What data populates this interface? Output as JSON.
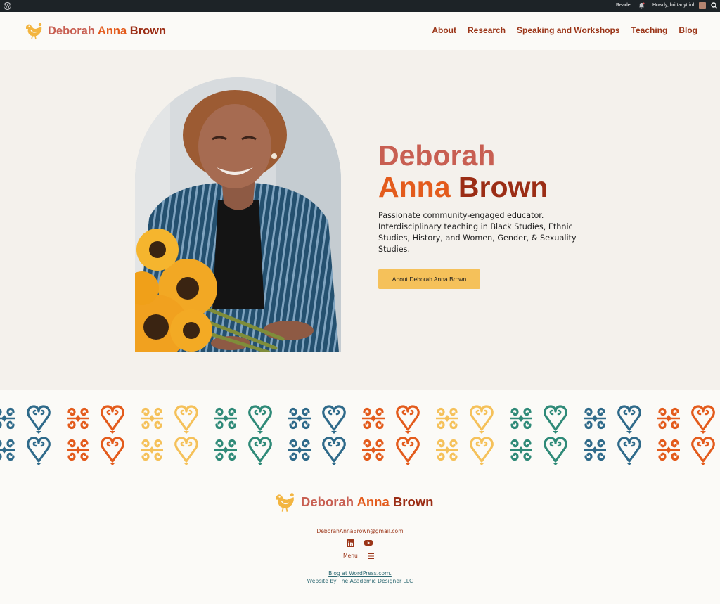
{
  "admin_bar": {
    "wp_logo": "wordpress-icon",
    "reader": "Reader",
    "notifications": "bell-icon",
    "howdy": "Howdy, brittanytrinh",
    "search": "search-icon"
  },
  "site": {
    "title_part1": "Deborah",
    "title_part2": "Anna",
    "title_part3": "Brown",
    "colors": {
      "rose": "#c85f52",
      "orange": "#e35b1c",
      "rust": "#9b2d15",
      "gold": "#f5c15a",
      "teal": "#2f8a78",
      "blue": "#2f6a8a"
    }
  },
  "nav": {
    "items": [
      {
        "label": "About"
      },
      {
        "label": "Research"
      },
      {
        "label": "Speaking and Workshops"
      },
      {
        "label": "Teaching"
      },
      {
        "label": "Blog"
      }
    ]
  },
  "hero": {
    "title_line1": "Deborah",
    "title_line2a": "Anna",
    "title_line2b": "Brown",
    "description": "Passionate community-engaged educator. Interdisciplinary teaching in Black Studies, Ethnic Studies, History, and Women, Gender, & Sexuality Studies.",
    "button_label": "About Deborah Anna Brown"
  },
  "footer": {
    "title_part1": "Deborah",
    "title_part2": "Anna",
    "title_part3": "Brown",
    "email": "DeborahAnnaBrown@gmail.com",
    "social": [
      "linkedin-icon",
      "youtube-icon"
    ],
    "menu_label": "Menu",
    "credit_link": "Blog at WordPress.com.",
    "credit_prefix": "Website by ",
    "credit_designer": "The Academic Designer LLC"
  }
}
